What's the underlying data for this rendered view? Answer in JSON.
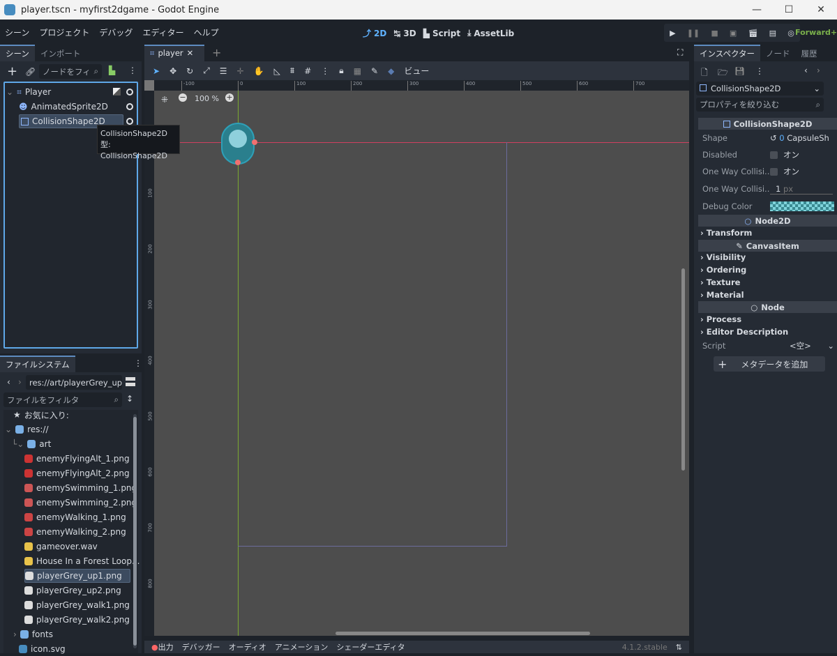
{
  "window": {
    "title": "player.tscn - myfirst2dgame - Godot Engine",
    "minimize": "—",
    "maximize": "☐",
    "close": "✕"
  },
  "menu": {
    "items": [
      "シーン",
      "プロジェクト",
      "デバッグ",
      "エディター",
      "ヘルプ"
    ]
  },
  "workspaces": [
    {
      "label": "2D",
      "icon": "2d-icon",
      "active": true
    },
    {
      "label": "3D",
      "icon": "3d-icon"
    },
    {
      "label": "Script",
      "icon": "script-icon"
    },
    {
      "label": "AssetLib",
      "icon": "download-icon"
    }
  ],
  "run": {
    "renderer": "Forward+",
    "renderer_color": "#7ab04b"
  },
  "scene_dock": {
    "tabs": [
      "シーン",
      "インポート"
    ],
    "filter_placeholder": "ノードをフィ",
    "nodes": [
      {
        "name": "Player",
        "icon": "node2d-icon"
      },
      {
        "name": "AnimatedSprite2D",
        "icon": "animated-sprite-icon"
      },
      {
        "name": "CollisionShape2D",
        "icon": "collision-shape-icon",
        "selected": true
      }
    ],
    "tooltip": {
      "line1": "CollisionShape2D",
      "line2": "型: CollisionShape2D"
    }
  },
  "filesystem": {
    "tab": "ファイルシステム",
    "path": "res://art/playerGrey_up",
    "filter_placeholder": "ファイルをフィルタ",
    "favorites": "お気に入り:",
    "root": "res://",
    "folder": "art",
    "files": [
      {
        "name": "enemyFlyingAlt_1.png"
      },
      {
        "name": "enemyFlyingAlt_2.png"
      },
      {
        "name": "enemySwimming_1.png"
      },
      {
        "name": "enemySwimming_2.png"
      },
      {
        "name": "enemyWalking_1.png"
      },
      {
        "name": "enemyWalking_2.png"
      },
      {
        "name": "gameover.wav"
      },
      {
        "name": "House In a Forest Loop..."
      },
      {
        "name": "playerGrey_up1.png",
        "selected": true
      },
      {
        "name": "playerGrey_up2.png"
      },
      {
        "name": "playerGrey_walk1.png"
      },
      {
        "name": "playerGrey_walk2.png"
      }
    ],
    "after": [
      {
        "name": "fonts",
        "type": "folder"
      },
      {
        "name": "icon.svg",
        "type": "file"
      }
    ]
  },
  "editor": {
    "tab": "player",
    "view_menu": "ビュー",
    "zoom": "100 %",
    "ruler_h": [
      "-100",
      "0",
      "100",
      "200",
      "300",
      "400",
      "500",
      "600",
      "700"
    ],
    "ruler_v": [
      "100",
      "200",
      "300",
      "400",
      "500",
      "600",
      "700",
      "800"
    ]
  },
  "bottom": {
    "tabs": [
      "出力",
      "デバッガー",
      "オーディオ",
      "アニメーション",
      "シェーダーエディタ"
    ],
    "version": "4.1.2.stable"
  },
  "inspector": {
    "tabs": [
      "インスペクター",
      "ノード",
      "履歴"
    ],
    "object": "CollisionShape2D",
    "filter_placeholder": "プロパティを絞り込む",
    "section": "CollisionShape2D",
    "props": [
      {
        "label": "Shape",
        "value": "CapsuleSh"
      },
      {
        "label": "Disabled",
        "value": "オン"
      },
      {
        "label": "One Way Collisi...",
        "value": "オン"
      },
      {
        "label": "One Way Collisi...",
        "value": "1",
        "unit": "px"
      },
      {
        "label": "Debug Color",
        "value": ""
      }
    ],
    "node2d": "Node2D",
    "transform": "Transform",
    "canvas_item": "CanvasItem",
    "canvas_groups": [
      "Visibility",
      "Ordering",
      "Texture",
      "Material"
    ],
    "node": "Node",
    "node_groups": [
      "Process",
      "Editor Description"
    ],
    "script_label": "Script",
    "script_value": "<空>",
    "add_metadata": "メタデータを追加",
    "debug_color": "#7fd3db"
  }
}
